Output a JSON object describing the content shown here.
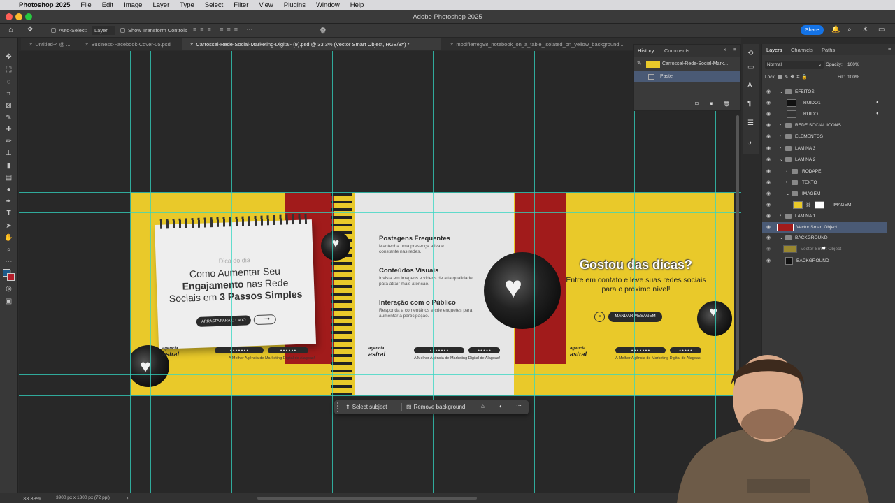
{
  "menubar": {
    "apple": "",
    "app": "Photoshop 2025",
    "items": [
      "File",
      "Edit",
      "Image",
      "Layer",
      "Type",
      "Select",
      "Filter",
      "View",
      "Plugins",
      "Window",
      "Help"
    ]
  },
  "window": {
    "title": "Adobe Photoshop 2025"
  },
  "options": {
    "auto_select_label": "Auto-Select:",
    "auto_select_value": "Layer",
    "show_transform": "Show Transform Controls",
    "share": "Share"
  },
  "tabs": [
    "Untitled-4 @ ...",
    "Business-Facebook-Cover-05.psd",
    "Carrossel-Rede-Social-Marketing-Digital- (9).psd @ 33,3% (Vector Smart Object, RGB/8#) *",
    "modifierreg98_notebook_on_a_table_isolated_on_yellow_background..."
  ],
  "artwork": {
    "slide1": {
      "tag": "Dica do dia",
      "title_line1": "Como Aumentar Seu",
      "title_line2_bold": "Engajamento",
      "title_line2_rest": " nas Rede",
      "title_line3_pre": "Sociais em ",
      "title_line3_bold": "3 Passos Simples",
      "button": "ARRASTA PARA O LADO",
      "arrow": "⟶"
    },
    "slide2": {
      "s1_title": "Postagens Frequentes",
      "s1_body": "Mantenha uma presença ativa e constante nas redes.",
      "s2_title": "Conteúdos Visuais",
      "s2_body": "Invista em imagens e vídeos de alta qualidade para atrair mais atenção.",
      "s3_title": "Interação com o Público",
      "s3_body": "Responda a comentários e crie enquetes para aumentar a participação."
    },
    "slide3": {
      "title": "Gostou das dicas?",
      "sub": "Entre em contato e leve suas redes sociais para o próximo nível!",
      "button": "MANDAR MESAGEM"
    },
    "footer": {
      "logo_top": "agencia",
      "logo": "astral",
      "pill1": "● ● ● ● ● ● ●",
      "pill2": "● ● ● ● ● ●",
      "pill3": "● ● ● ● ●",
      "tagline": "A Melhor Agência de Marketing Digital de Alagoas!"
    }
  },
  "context_bar": {
    "select_subject": "Select subject",
    "remove_background": "Remove background"
  },
  "status": {
    "zoom": "33.33%",
    "doc_info": "3900 px x 1300 px (72 ppi)"
  },
  "history": {
    "tab1": "History",
    "tab2": "Comments",
    "snapshot": "Carrossel-Rede-Social-Mark...",
    "item": "Paste"
  },
  "layers": {
    "tab1": "Layers",
    "tab2": "Channels",
    "tab3": "Paths",
    "blend": "Normal",
    "opacity_label": "Opacity:",
    "opacity": "100%",
    "lock_label": "Lock:",
    "fill_label": "Fill:",
    "fill": "100%",
    "rows": [
      "EFEITOS",
      "RUIDO1",
      "RUIDO",
      "REDE SOCIAL ICONS",
      "ELEMENTOS",
      "LAMINA 3",
      "LAMINA 2",
      "RODAPE",
      "TEXTO",
      "IMAGEM",
      "IMAGEM",
      "LAMINA 1",
      "Vector Smart Object",
      "BACKGROUND",
      "Vector Smart Object",
      "BACKGROUND"
    ]
  },
  "colors": {
    "accent": "#1473e6",
    "guide": "#33d6c2",
    "artboard": "#e9c92a",
    "red": "#a11b1b"
  }
}
